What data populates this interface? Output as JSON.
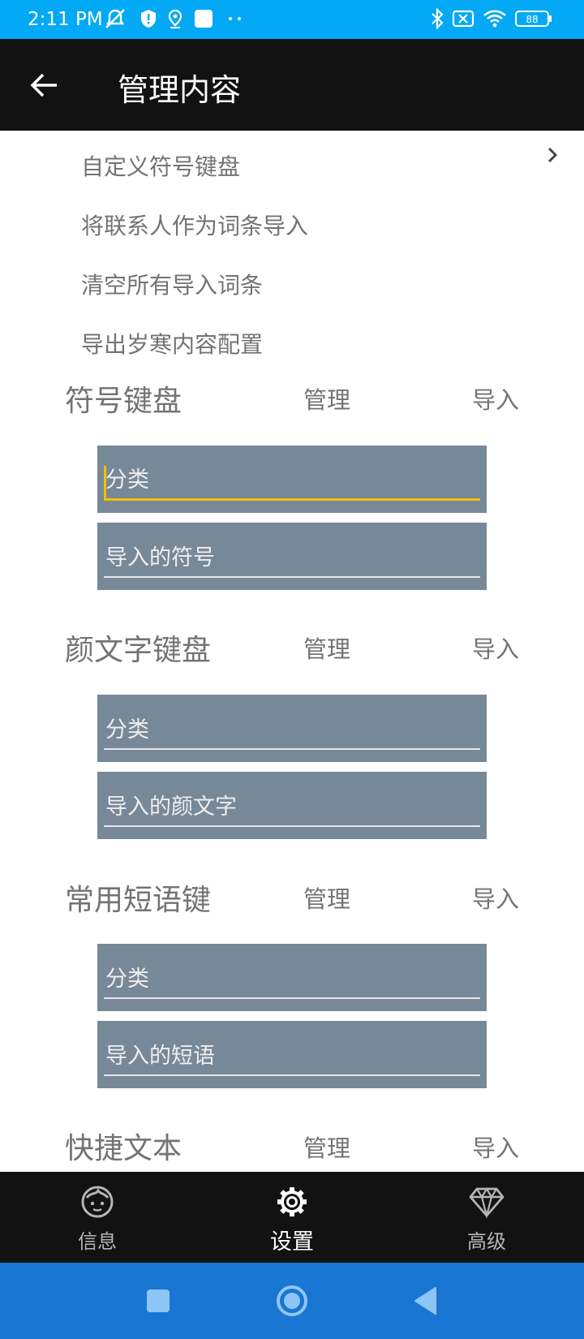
{
  "status_bar": {
    "time": "2:11 PM",
    "battery": "88",
    "icons": [
      "mute-notifications-icon",
      "shield-icon",
      "location-icon",
      "square-icon",
      "more-dots-icon",
      "bluetooth-icon",
      "no-sim-icon",
      "wifi-icon",
      "battery-icon"
    ],
    "color": "#03a9f4"
  },
  "app_bar": {
    "title": "管理内容",
    "back_icon": "arrow-left-icon"
  },
  "menu": {
    "items": [
      {
        "label": "自定义符号键盘"
      },
      {
        "label": "将联系人作为词条导入"
      },
      {
        "label": "清空所有导入词条"
      },
      {
        "label": "导出岁寒内容配置"
      }
    ],
    "chevron_icon": "chevron-right-icon"
  },
  "sections": [
    {
      "title": "符号键盘",
      "manage": "管理",
      "import": "导入",
      "category_placeholder": "分类",
      "content_placeholder": "导入的符号"
    },
    {
      "title": "颜文字键盘",
      "manage": "管理",
      "import": "导入",
      "category_placeholder": "分类",
      "content_placeholder": "导入的颜文字"
    },
    {
      "title": "常用短语键",
      "manage": "管理",
      "import": "导入",
      "category_placeholder": "分类",
      "content_placeholder": "导入的短语"
    },
    {
      "title": "快捷文本",
      "manage": "管理",
      "import": "导入"
    }
  ],
  "bottom_nav": {
    "items": [
      {
        "label": "信息",
        "icon": "face-icon",
        "active": false
      },
      {
        "label": "设置",
        "icon": "gear-icon",
        "active": true
      },
      {
        "label": "高级",
        "icon": "diamond-icon",
        "active": false
      }
    ]
  },
  "system_nav": {
    "icons": [
      "recents-square-icon",
      "home-circle-icon",
      "back-triangle-icon"
    ],
    "color": "#1976d2"
  },
  "colors": {
    "field_background": "#778899",
    "focus_accent": "#f5bf00",
    "text_gray": "#737373"
  }
}
